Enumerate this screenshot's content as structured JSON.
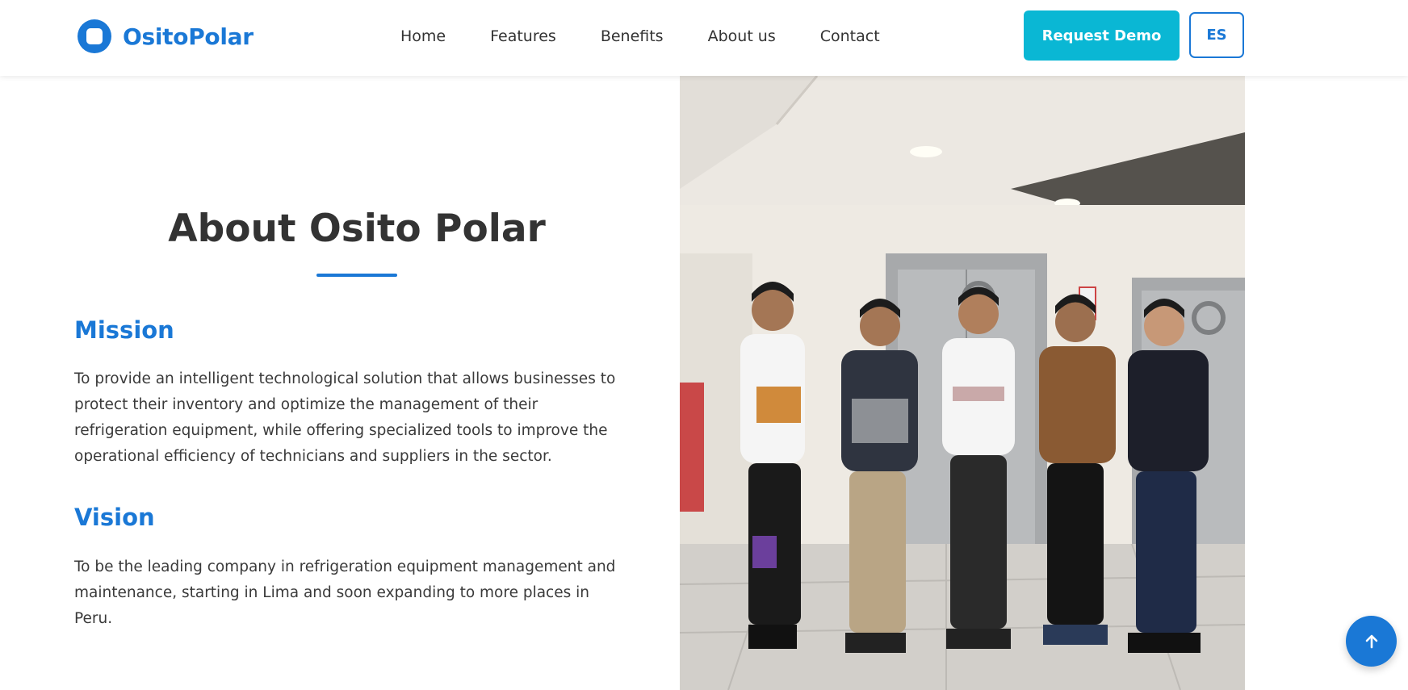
{
  "brand": {
    "name": "OsitoPolar",
    "color": "#1a78d6"
  },
  "nav": {
    "items": [
      {
        "label": "Home"
      },
      {
        "label": "Features"
      },
      {
        "label": "Benefits"
      },
      {
        "label": "About us"
      },
      {
        "label": "Contact"
      }
    ]
  },
  "header": {
    "demo_label": "Request Demo",
    "demo_color": "#0ab7d4",
    "lang_label": "ES"
  },
  "about": {
    "title": "About Osito Polar",
    "mission": {
      "heading": "Mission",
      "body": "To provide an intelligent technological solution that allows businesses to protect their inventory and optimize the management of their refrigeration equipment, while offering specialized tools to improve the operational efficiency of technicians and suppliers in the sector."
    },
    "vision": {
      "heading": "Vision",
      "body": "To be the leading company in refrigeration equipment management and maintenance, starting in Lima and soon expanding to more places in Peru."
    }
  },
  "icons": {
    "logo": "logo-icon",
    "scroll_top": "arrow-up-icon"
  }
}
